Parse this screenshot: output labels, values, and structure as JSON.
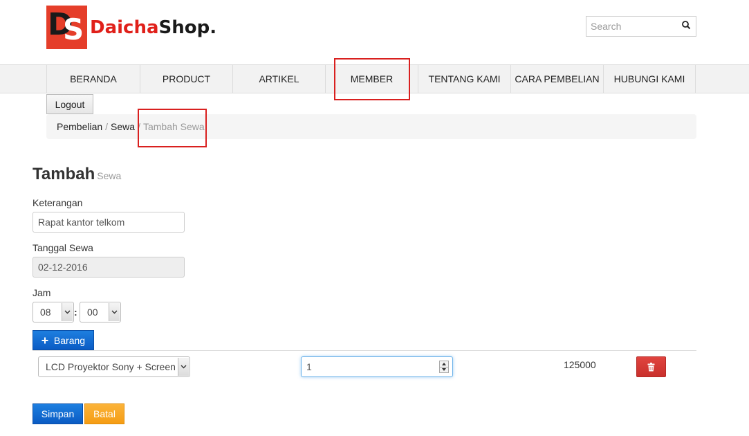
{
  "header": {
    "logo_badge_left": "D",
    "logo_badge_right": "S",
    "logo_name_red": "Daicha",
    "logo_name_black": "Shop.",
    "search_placeholder": "Search"
  },
  "nav": {
    "items": [
      {
        "label": "BERANDA"
      },
      {
        "label": "PRODUCT"
      },
      {
        "label": "ARTIKEL"
      },
      {
        "label": "MEMBER"
      },
      {
        "label": "TENTANG KAMI"
      },
      {
        "label": "CARA PEMBELIAN"
      },
      {
        "label": "HUBUNGI KAMI"
      }
    ],
    "logout_label": "Logout"
  },
  "breadcrumb": {
    "items": [
      "Pembelian",
      "Sewa"
    ],
    "active": "Tambah Sewa",
    "separator": "/"
  },
  "form": {
    "title": "Tambah",
    "subtitle": "Sewa",
    "keterangan_label": "Keterangan",
    "keterangan_value": "Rapat kantor telkom",
    "tanggal_label": "Tanggal Sewa",
    "tanggal_value": "02-12-2016",
    "jam_label": "Jam",
    "jam_hour": "08",
    "jam_separator": ":",
    "jam_minute": "00",
    "add_item_label": "Barang",
    "add_item_icon": "plus-icon"
  },
  "items": [
    {
      "product": "LCD Proyektor Sony + Screen",
      "quantity": "1",
      "price": "125000"
    }
  ],
  "actions": {
    "save_label": "Simpan",
    "cancel_label": "Batal"
  },
  "colors": {
    "brand_red": "#e53e2a",
    "primary_blue": "#0a5bc4",
    "warning_orange": "#f59d14",
    "danger_red": "#c9302c",
    "annotation_red": "#d9201f"
  }
}
